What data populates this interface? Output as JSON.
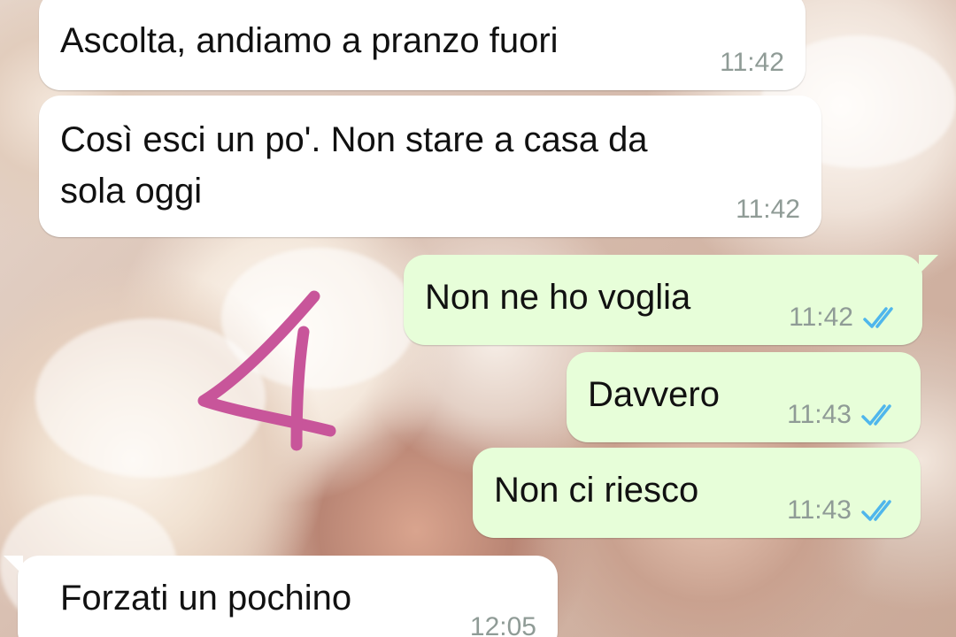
{
  "messages": [
    {
      "text": "Ascolta, andiamo a pranzo fuori",
      "time": "11:42",
      "direction": "incoming"
    },
    {
      "text_lines": [
        "Così esci un po'. Non stare a casa da",
        "sola oggi"
      ],
      "time": "11:42",
      "direction": "incoming"
    },
    {
      "text": "Non ne ho voglia",
      "time": "11:42",
      "direction": "outgoing",
      "status": "read-double-check-icon"
    },
    {
      "text": "Davvero",
      "time": "11:43",
      "direction": "outgoing",
      "status": "read-double-check-icon"
    },
    {
      "text": "Non ci riesco",
      "time": "11:43",
      "direction": "outgoing",
      "status": "read-double-check-icon"
    },
    {
      "text": "Forzati un pochino",
      "time": "12:05",
      "direction": "incoming"
    }
  ],
  "annotation": {
    "mark": "4",
    "color": "#c8559a"
  },
  "colors": {
    "incoming_bubble": "#ffffff",
    "outgoing_bubble": "#e7fed9",
    "read_ticks": "#4fb6ec",
    "timestamp": "#8f9b96"
  }
}
